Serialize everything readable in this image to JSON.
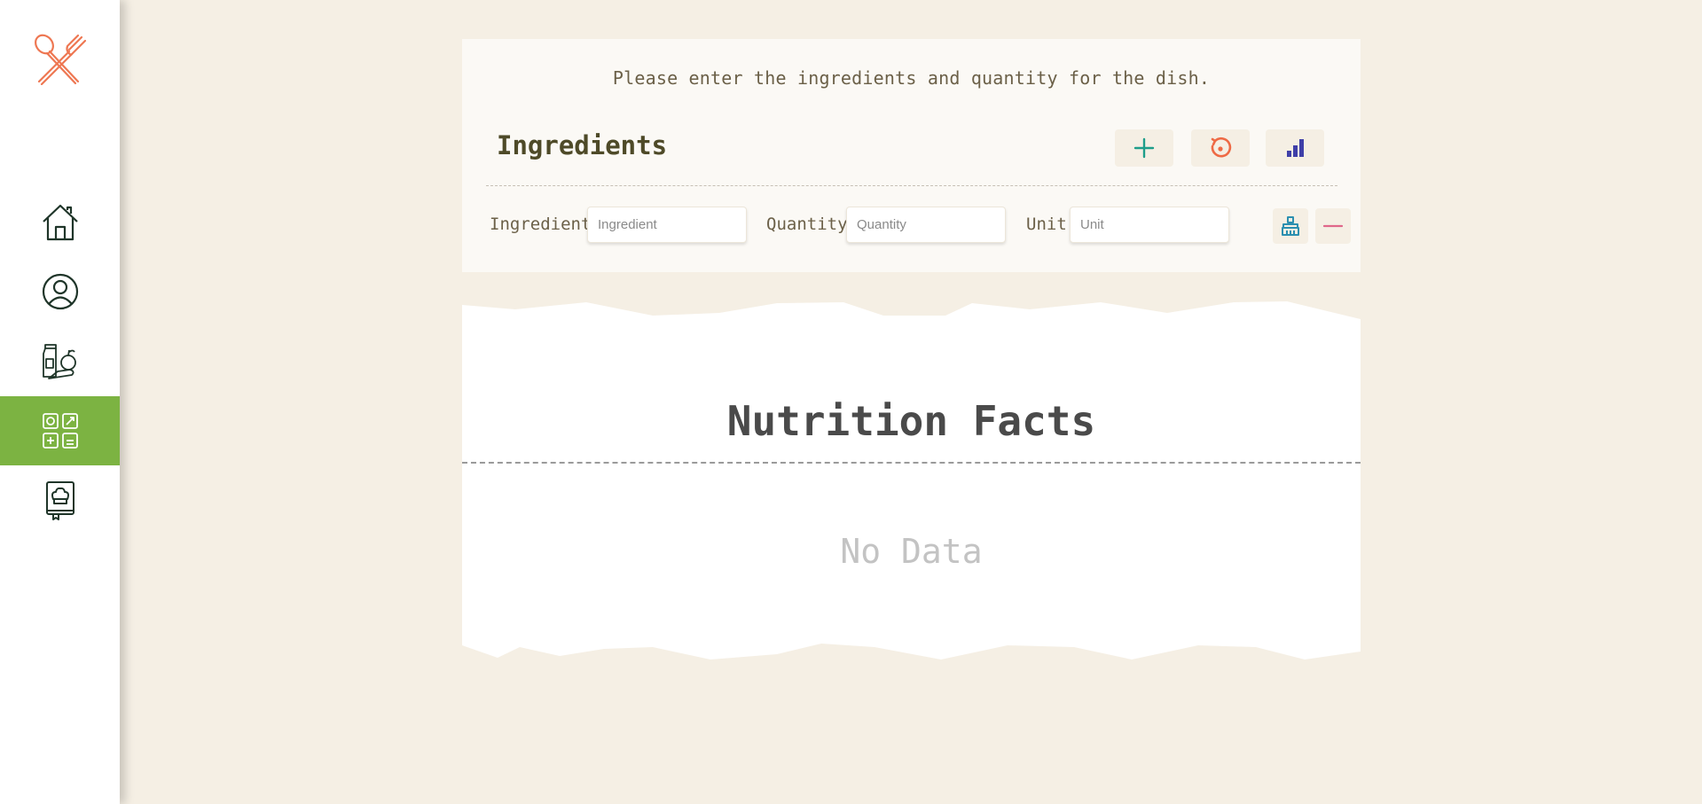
{
  "sidebar": {
    "logo_icon": "fork-spoon-icon",
    "items": [
      {
        "key": "home",
        "icon": "home-icon",
        "active": false
      },
      {
        "key": "profile",
        "icon": "user-profile-icon",
        "active": false
      },
      {
        "key": "grocery",
        "icon": "grocery-icon",
        "active": false
      },
      {
        "key": "nutrition",
        "icon": "nutrition-calculator-icon",
        "active": true
      },
      {
        "key": "recipes",
        "icon": "recipe-book-icon",
        "active": false
      }
    ],
    "active_color": "#7cb342"
  },
  "ingredients_panel": {
    "prompt": "Please enter the ingredients and quantity for the dish.",
    "title": "Ingredients",
    "actions": {
      "add_icon": "plus-icon",
      "reset_icon": "reset-icon",
      "analyze_icon": "bar-chart-icon"
    },
    "row": {
      "ingredient_label": "Ingredient",
      "ingredient_placeholder": "Ingredient",
      "ingredient_value": "",
      "quantity_label": "Quantity",
      "quantity_placeholder": "Quantity",
      "quantity_value": "",
      "unit_label": "Unit",
      "unit_placeholder": "Unit",
      "unit_value": "",
      "clear_icon": "broom-icon",
      "remove_icon": "minus-icon"
    }
  },
  "nutrition": {
    "title": "Nutrition Facts",
    "empty_text": "No Data"
  },
  "colors": {
    "background": "#f5efe4",
    "accent_green": "#7cb342",
    "logo_orange": "#ee7752",
    "add_teal": "#1e9e8a",
    "reset_orange": "#ee6a45",
    "chart_indigo": "#3f3fa8",
    "clear_blue": "#2b8fb0",
    "remove_pink": "#e0678a"
  }
}
